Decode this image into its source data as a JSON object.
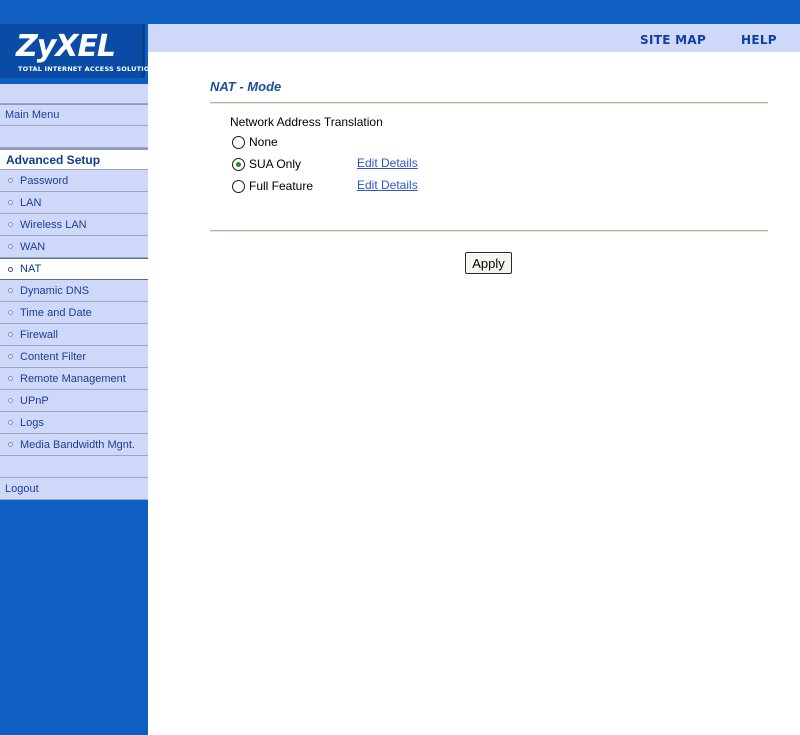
{
  "header": {
    "logo": "ZyXEL",
    "tagline": "TOTAL INTERNET ACCESS SOLUTION",
    "links": {
      "site_map": "SITE MAP",
      "help": "HELP"
    }
  },
  "sidebar": {
    "main_menu": "Main Menu",
    "section_heading": "Advanced Setup",
    "items": [
      {
        "label": "Password"
      },
      {
        "label": "LAN"
      },
      {
        "label": "Wireless LAN"
      },
      {
        "label": "WAN"
      },
      {
        "label": "NAT",
        "active": true
      },
      {
        "label": "Dynamic DNS"
      },
      {
        "label": "Time and Date"
      },
      {
        "label": "Firewall"
      },
      {
        "label": "Content Filter"
      },
      {
        "label": "Remote Management"
      },
      {
        "label": "UPnP"
      },
      {
        "label": "Logs"
      },
      {
        "label": "Media Bandwidth Mgnt."
      }
    ],
    "logout": "Logout"
  },
  "main": {
    "title": "NAT - Mode",
    "section_label": "Network Address Translation",
    "options": [
      {
        "label": "None",
        "checked": false
      },
      {
        "label": "SUA Only",
        "checked": true,
        "link": "Edit Details"
      },
      {
        "label": "Full Feature",
        "checked": false,
        "link": "Edit Details"
      }
    ],
    "apply_label": "Apply"
  },
  "colors": {
    "brand_blue": "#0f5fc3",
    "menu_bg": "#cfd8f8",
    "link": "#2b55c9",
    "title": "#1a4f9a"
  }
}
